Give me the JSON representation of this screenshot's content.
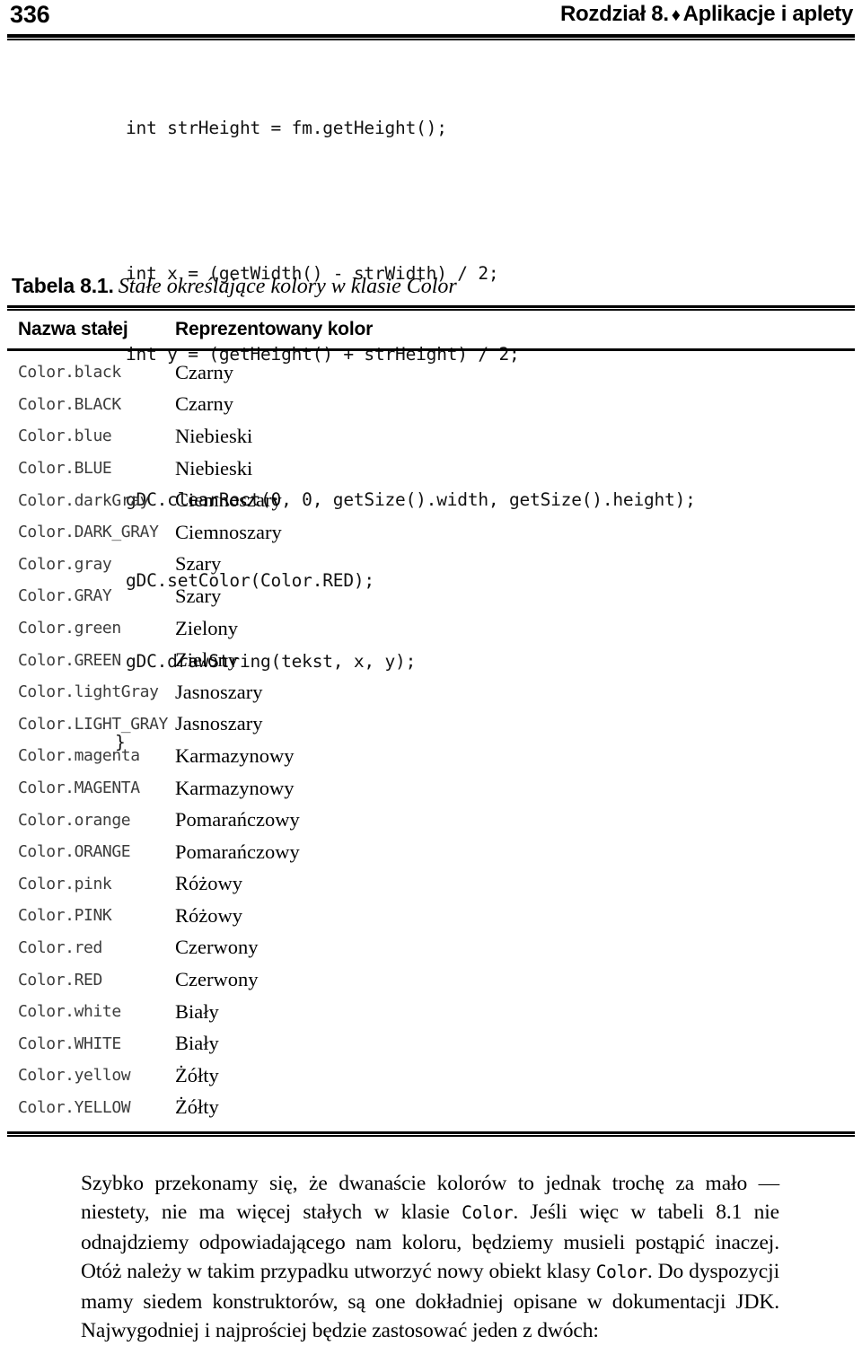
{
  "header": {
    "folio": "336",
    "chapter_label": "Rozdział 8.",
    "separator_icon": "♦",
    "chapter_title": "Aplikacje i aplety"
  },
  "code_listing": {
    "lines": [
      "int strHeight = fm.getHeight();",
      "",
      "int x = (getWidth() - strWidth) / 2;",
      "int y = (getHeight() + strHeight) / 2;",
      "",
      "gDC.clearRect(0, 0, getSize().width, getSize().height);",
      "gDC.setColor(Color.RED);",
      "gDC.drawString(tekst, x, y);"
    ],
    "closing_brace": "}"
  },
  "table": {
    "caption_label": "Tabela 8.1.",
    "caption_title": "Stałe określające kolory w klasie Color",
    "headers": {
      "name": "Nazwa stałej",
      "description": "Reprezentowany kolor"
    },
    "rows": [
      {
        "name": "Color.black",
        "description": "Czarny"
      },
      {
        "name": "Color.BLACK",
        "description": "Czarny"
      },
      {
        "name": "Color.blue",
        "description": "Niebieski"
      },
      {
        "name": "Color.BLUE",
        "description": "Niebieski"
      },
      {
        "name": "Color.darkGray",
        "description": "Ciemnoszary"
      },
      {
        "name": "Color.DARK_GRAY",
        "description": "Ciemnoszary"
      },
      {
        "name": "Color.gray",
        "description": "Szary"
      },
      {
        "name": "Color.GRAY",
        "description": "Szary"
      },
      {
        "name": "Color.green",
        "description": "Zielony"
      },
      {
        "name": "Color.GREEN",
        "description": "Zielony"
      },
      {
        "name": "Color.lightGray",
        "description": "Jasnoszary"
      },
      {
        "name": "Color.LIGHT_GRAY",
        "description": "Jasnoszary"
      },
      {
        "name": "Color.magenta",
        "description": "Karmazynowy"
      },
      {
        "name": "Color.MAGENTA",
        "description": "Karmazynowy"
      },
      {
        "name": "Color.orange",
        "description": "Pomarańczowy"
      },
      {
        "name": "Color.ORANGE",
        "description": "Pomarańczowy"
      },
      {
        "name": "Color.pink",
        "description": "Różowy"
      },
      {
        "name": "Color.PINK",
        "description": "Różowy"
      },
      {
        "name": "Color.red",
        "description": "Czerwony"
      },
      {
        "name": "Color.RED",
        "description": "Czerwony"
      },
      {
        "name": "Color.white",
        "description": "Biały"
      },
      {
        "name": "Color.WHITE",
        "description": "Biały"
      },
      {
        "name": "Color.yellow",
        "description": "Żółty"
      },
      {
        "name": "Color.YELLOW",
        "description": "Żółty"
      }
    ]
  },
  "paragraph": {
    "part1": "Szybko przekonamy się, że dwanaście kolorów to jednak trochę za mało — niestety, nie ma więcej stałych w klasie ",
    "mono1": "Color",
    "part2": ". Jeśli więc w tabeli 8.1 nie odnajdziemy odpowiadającego nam koloru, będziemy musieli postąpić inaczej. Otóż należy w takim przypadku utworzyć nowy obiekt klasy ",
    "mono2": "Color",
    "part3": ". Do dyspozycji mamy siedem konstruktorów, są one dokładniej opisane w dokumentacji JDK. Najwygodniej i najprościej będzie zastosować jeden z dwóch:"
  }
}
